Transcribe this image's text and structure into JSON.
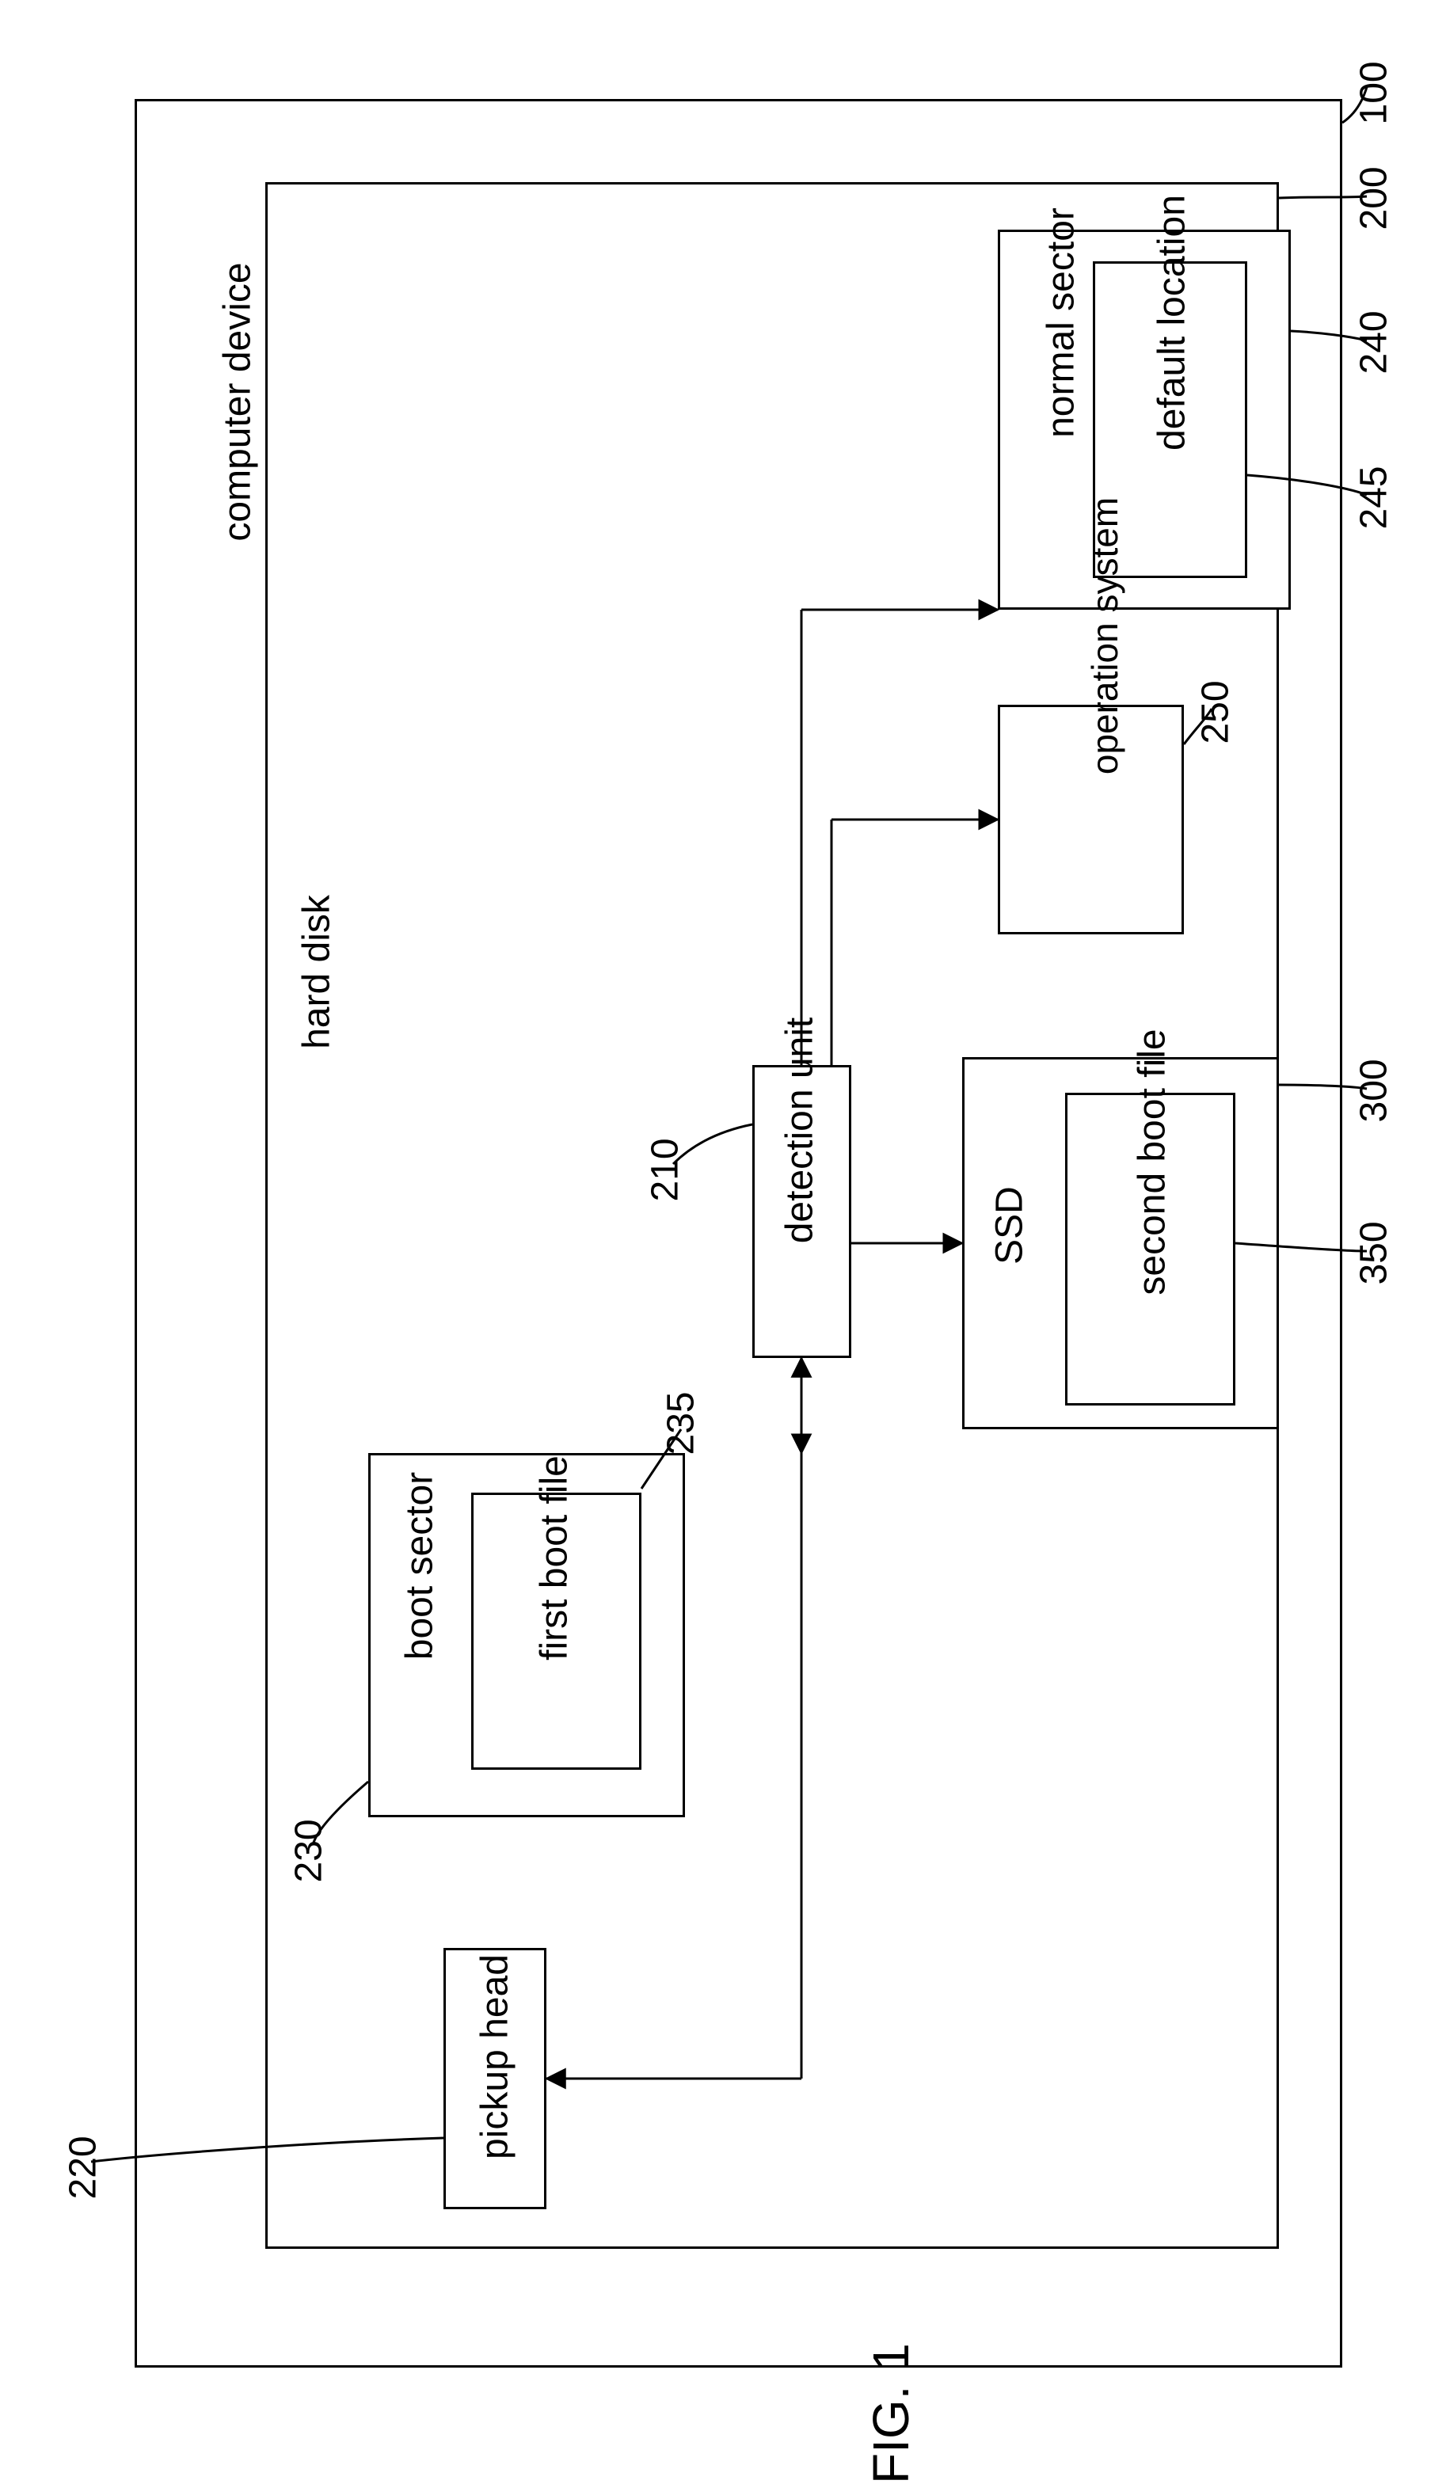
{
  "figure_label": "FIG. 1",
  "computer_device": {
    "title": "computer device",
    "ref": "100"
  },
  "hard_disk": {
    "title": "hard disk",
    "ref": "200"
  },
  "pickup_head": {
    "title": "pickup head",
    "ref": "220"
  },
  "boot_sector": {
    "title": "boot sector",
    "ref": "230"
  },
  "first_boot_file": {
    "title": "first boot file",
    "ref": "235"
  },
  "detection_unit": {
    "title": "detection unit",
    "ref": "210"
  },
  "normal_sector": {
    "title": "normal sector",
    "ref": "240"
  },
  "default_location": {
    "title": "default location",
    "ref": "245"
  },
  "operation_system": {
    "title": "operation system",
    "ref": "250"
  },
  "ssd": {
    "title": "SSD",
    "ref": "300"
  },
  "second_boot_file": {
    "title": "second boot file",
    "ref": "350"
  }
}
